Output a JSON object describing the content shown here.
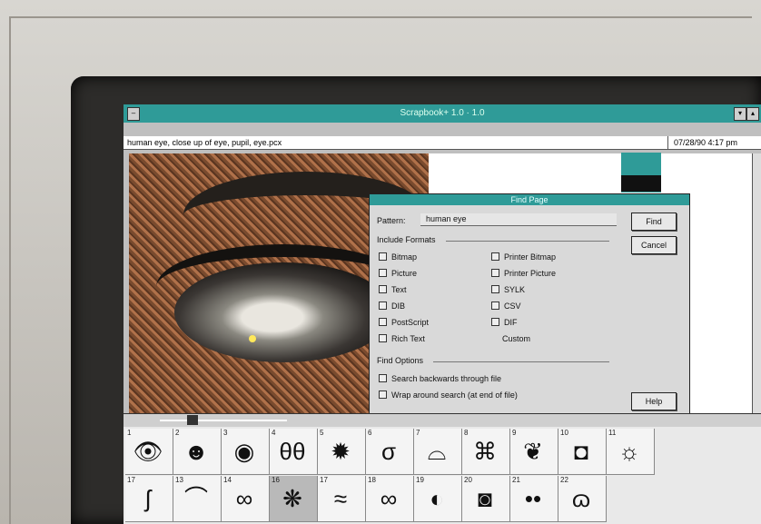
{
  "window": {
    "title": "Scrapbook+ 1.0 · 1.0",
    "minimize": "▾",
    "maximize": "▴"
  },
  "document": {
    "name": "human eye, close up of eye, pupil, eye.pcx",
    "timestamp": "07/28/90  4:17 pm"
  },
  "find_dialog": {
    "title": "Find Page",
    "pattern_label": "Pattern:",
    "pattern_value": "human eye",
    "find_button": "Find",
    "cancel_button": "Cancel",
    "help_button": "Help",
    "include_formats_title": "Include Formats",
    "formats_left": [
      "Bitmap",
      "Picture",
      "Text",
      "DIB",
      "PostScript",
      "Rich Text"
    ],
    "formats_right": [
      "Printer Bitmap",
      "Printer Picture",
      "SYLK",
      "CSV",
      "DIF",
      "Custom"
    ],
    "find_options_title": "Find Options",
    "option_backwards": "Search backwards through file",
    "option_wrap": "Wrap around search (at end of file)"
  },
  "thumbnails": [
    {
      "num": "1",
      "glyph": "👁"
    },
    {
      "num": "2",
      "glyph": "☻"
    },
    {
      "num": "3",
      "glyph": "◉"
    },
    {
      "num": "4",
      "glyph": "θθ"
    },
    {
      "num": "5",
      "glyph": "✹"
    },
    {
      "num": "6",
      "glyph": "σ"
    },
    {
      "num": "7",
      "glyph": "⌓"
    },
    {
      "num": "8",
      "glyph": "⌘"
    },
    {
      "num": "9",
      "glyph": "❦"
    },
    {
      "num": "10",
      "glyph": "◘"
    },
    {
      "num": "11",
      "glyph": "☼"
    },
    {
      "num": "17",
      "glyph": "ʃ"
    },
    {
      "num": "13",
      "glyph": "⌒"
    },
    {
      "num": "14",
      "glyph": "∞"
    },
    {
      "num": "16",
      "glyph": "❋"
    },
    {
      "num": "17",
      "glyph": "≈"
    },
    {
      "num": "18",
      "glyph": "∞"
    },
    {
      "num": "19",
      "glyph": "◐"
    },
    {
      "num": "20",
      "glyph": "◙"
    },
    {
      "num": "21",
      "glyph": "••"
    },
    {
      "num": "22",
      "glyph": "ɷ"
    }
  ]
}
